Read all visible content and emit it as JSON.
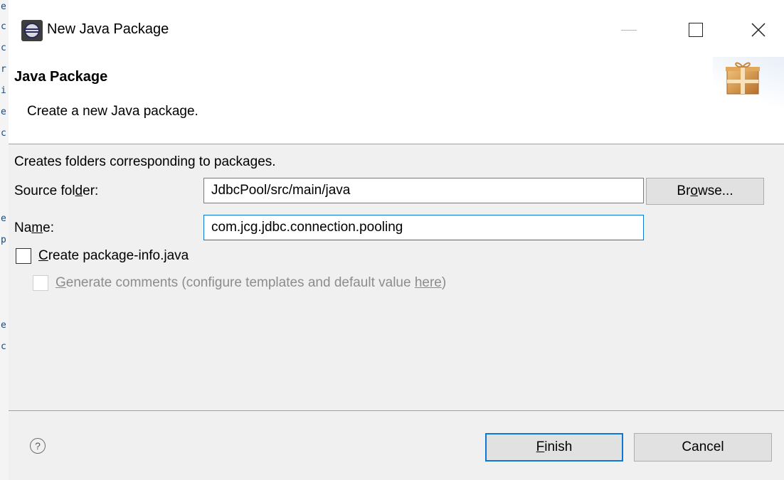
{
  "window": {
    "title": "New Java Package",
    "minimize_label": "",
    "maximize_label": "",
    "close_label": "✕"
  },
  "banner": {
    "title": "Java Package",
    "description": "Create a new Java package.",
    "icon": "package-gift-icon"
  },
  "form": {
    "description": "Creates folders corresponding to packages.",
    "source_folder": {
      "label_before": "Source fol",
      "label_mnemonic": "d",
      "label_after": "er:",
      "value": "JdbcPool/src/main/java"
    },
    "browse": {
      "label_before": "Br",
      "label_mnemonic": "o",
      "label_after": "wse..."
    },
    "name": {
      "label_before": "Na",
      "label_mnemonic": "m",
      "label_after": "e:",
      "value": "com.jcg.jdbc.connection.pooling"
    },
    "create_package_info": {
      "label_mnemonic": "C",
      "label_after": "reate package-info.java",
      "checked": false
    },
    "generate_comments": {
      "label_mnemonic": "G",
      "label_after": "enerate comments (configure templates and default value ",
      "link": "here",
      "label_end": ")",
      "checked": false,
      "enabled": false
    }
  },
  "footer": {
    "help": "?",
    "finish": {
      "mnemonic": "F",
      "rest": "inish"
    },
    "cancel": "Cancel"
  },
  "colors": {
    "accent": "#0a78d7",
    "dialog_bg": "#f0f0f0",
    "button_bg": "#e1e1e1"
  }
}
